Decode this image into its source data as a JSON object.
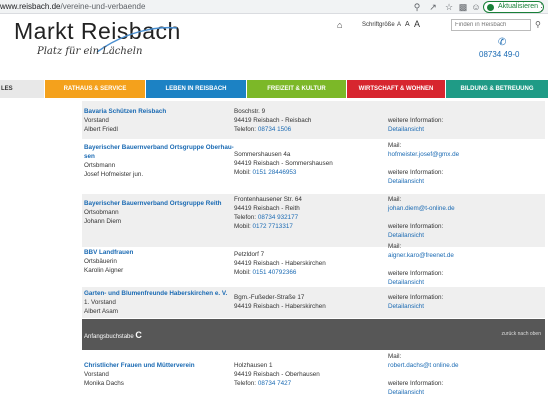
{
  "browser": {
    "url_host": "www.reisbach.de",
    "url_path": "/vereine-und-verbaende",
    "update_label": "Aktualisieren",
    "icons": [
      "zoom-icon",
      "share-icon",
      "star-icon",
      "extension-icon",
      "account-icon"
    ]
  },
  "header": {
    "logo_title": "Markt Reisbach",
    "slogan": "Platz für ein Lächeln",
    "font_size_label": "Schriftgröße",
    "font_size_small": "A",
    "font_size_medium": "A",
    "font_size_large": "A",
    "search_placeholder": "Finden in Reisbach",
    "phone": "08734 49-0"
  },
  "nav": [
    {
      "label": "LES",
      "color": "#e8e8e8"
    },
    {
      "label": "RATHAUS & SERVICE",
      "color": "#f4a11c"
    },
    {
      "label": "LEBEN IN REISBACH",
      "color": "#1c82c4"
    },
    {
      "label": "FREIZEIT & KULTUR",
      "color": "#7cb828"
    },
    {
      "label": "WIRTSCHAFT & WOHNEN",
      "color": "#d7262f"
    },
    {
      "label": "BILDUNG & BETREUUNG",
      "color": "#1f9b86"
    }
  ],
  "entries": [
    {
      "name": "Bavaria Schützen Reisbach",
      "role": "Vorstand",
      "person": "Albert Friedl",
      "street": "Boschstr. 9",
      "city": "94419 Reisbach - Reisbach",
      "phone_prefix": "Telefon:",
      "phone": "08734 1506",
      "info_label": "weitere Information:",
      "info_link": "Detailansicht"
    },
    {
      "name_line1": "Bayerischer Bauernverband Ortsgruppe Oberhau-",
      "name_line2": "sen",
      "role": "Ortsbmann",
      "person": "Josef Hofmeister jun.",
      "street": "Sommershausen 4a",
      "city": "94419 Reisbach - Sommershausen",
      "mobile_prefix": "Mobil:",
      "mobile": "0151 28446953",
      "mail_label": "Mail:",
      "mail": "hofmeister.josef@gmx.de",
      "info_label": "weitere Information:",
      "info_link": "Detailansicht"
    },
    {
      "name": "Bayerischer Bauernverband Ortsgruppe Reith",
      "role": "Ortsobmann",
      "person": "Johann Diem",
      "street": "Frontenhausener Str. 64",
      "city": "94419 Reisbach - Reith",
      "phone_prefix": "Telefon:",
      "phone": "08734 932177",
      "mobile_prefix": "Mobil:",
      "mobile": "0172 7713317",
      "mail_label": "Mail:",
      "mail": "johan.diem@t-online.de",
      "info_label": "weitere Information:",
      "info_link": "Detailansicht"
    },
    {
      "name": "BBV Landfrauen",
      "role": "Ortsbäuerin",
      "person": "Karolin Aigner",
      "street": "Petzldorf 7",
      "city": "94419 Reisbach - Haberskirchen",
      "mobile_prefix": "Mobil:",
      "mobile": "0151 40792366",
      "mail_label": "Mail:",
      "mail": "aigner.karo@freenet.de",
      "info_label": "weitere Information:",
      "info_link": "Detailansicht"
    },
    {
      "name": "Garten- und Blumenfreunde Haberskirchen e. V.",
      "role": "1. Vorstand",
      "person": "Albert Asam",
      "street": "Bgm.-Fußeder-Straße 17",
      "city": "94419 Reisbach - Haberskirchen",
      "info_label": "weitere Information:",
      "info_link": "Detailansicht"
    },
    {
      "name": "Christlicher Frauen und Mütterverein",
      "role": "Vorstand",
      "person": "Monika Dachs",
      "street": "Holzhausen 1",
      "city": "94419 Reisbach - Oberhausen",
      "phone_prefix": "Telefon:",
      "phone": "08734 7427",
      "mail_label": "Mail:",
      "mail": "robert.dachs@t online.de",
      "info_label": "weitere Information:",
      "info_link": "Detailansicht"
    }
  ],
  "letter_header": {
    "label": "Anfangsbuchstabe",
    "letter": "C",
    "back_label": "zurück nach oben"
  }
}
